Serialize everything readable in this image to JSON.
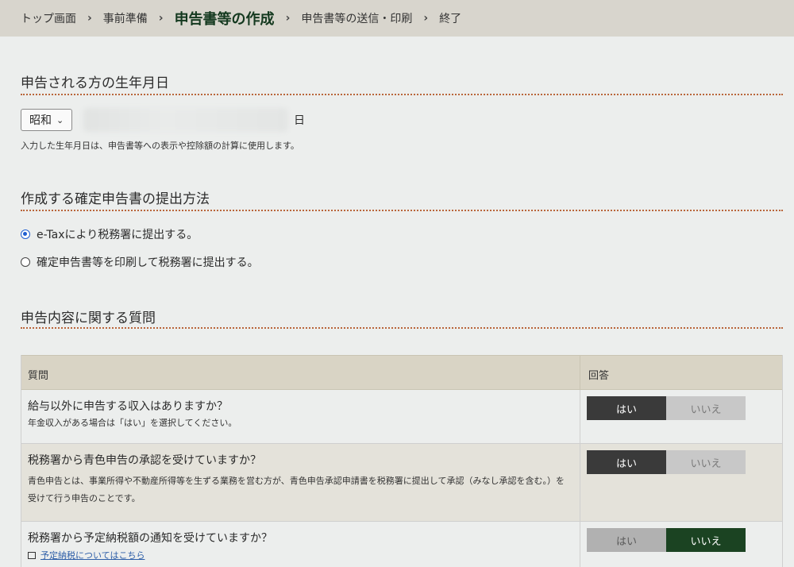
{
  "breadcrumb": [
    "トップ画面",
    "事前準備",
    "申告書等の作成",
    "申告書等の送信・印刷",
    "終了"
  ],
  "birthdate": {
    "title": "申告される方の生年月日",
    "era": "昭和",
    "day_suffix": "日",
    "help": "入力した生年月日は、申告書等への表示や控除額の計算に使用します。"
  },
  "method": {
    "title": "作成する確定申告書の提出方法",
    "options": [
      {
        "label": "e-Taxにより税務署に提出する。",
        "selected": true
      },
      {
        "label": "確定申告書等を印刷して税務署に提出する。",
        "selected": false
      }
    ]
  },
  "questions": {
    "title": "申告内容に関する質問",
    "header_question": "質問",
    "header_answer": "回答",
    "yes": "はい",
    "no": "いいえ",
    "rows": [
      {
        "question": "給与以外に申告する収入はありますか？",
        "note": "年金収入がある場合は「はい」を選択してください。",
        "answer": "yes"
      },
      {
        "question": "税務署から青色申告の承認を受けていますか？",
        "note": "青色申告とは、事業所得や不動産所得等を生ずる業務を営む方が、青色申告承認申請書を税務署に提出して承認（みなし承認を含む。）を受けて行う申告のことです。",
        "answer": "yes"
      },
      {
        "question": "税務署から予定納税額の通知を受けていますか？",
        "link": "予定納税についてはこちら",
        "answer": "no"
      }
    ]
  },
  "colors": {
    "active_crumb": "#14391f",
    "dotted_rule": "#b9653a",
    "yes_selected": "#3a3a3a",
    "no_selected": "#1b4322",
    "link": "#2f5fa8"
  }
}
